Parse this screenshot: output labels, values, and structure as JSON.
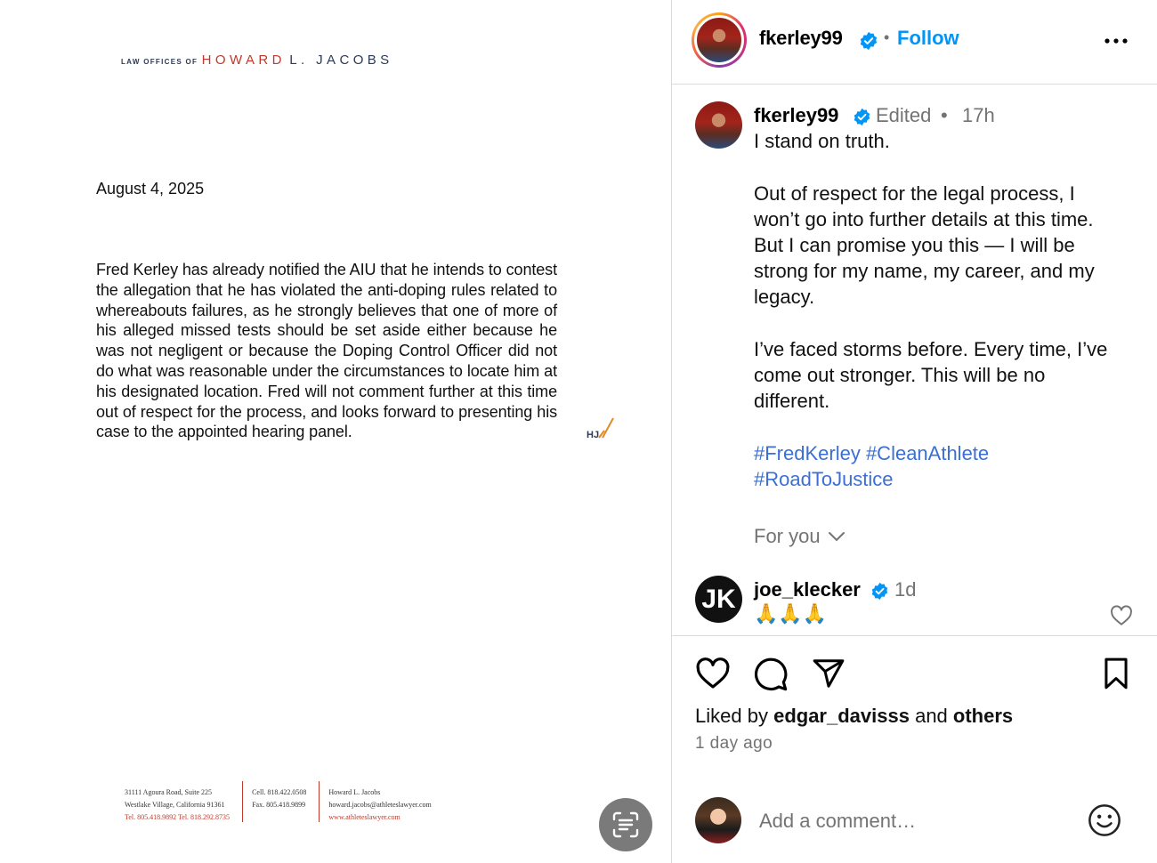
{
  "document": {
    "logo_prefix": "LAW OFFICES OF",
    "logo_firm_first": "HOWARD",
    "logo_firm_rest": "L. JACOBS",
    "date": "August 4, 2025",
    "body": "Fred Kerley has already notified the AIU that he intends to contest the allegation that he has violated the anti-doping rules related to whereabouts failures, as he strongly believes that one of more of his alleged missed tests should be set aside either because he was not negligent or because the Doping Control Officer did not do what was reasonable under the circumstances to locate him at his designated location.  Fred will not comment further at this time out of respect for the process, and looks forward to presenting his case to the appointed hearing panel.",
    "initials": "HJ",
    "footer": {
      "address_line1": "31111 Agoura Road, Suite 225",
      "address_line2": "Westlake Village, California 91361",
      "address_line3": "Tel. 805.418.9892  Tel. 818.292.8735",
      "cell": "Cell. 818.422.0508",
      "fax": "Fax. 805.418.9899",
      "name": "Howard L. Jacobs",
      "email": "howard.jacobs@athleteslawyer.com",
      "website": "www.athleteslawyer.com"
    }
  },
  "post": {
    "header": {
      "username": "fkerley99",
      "dot": "•",
      "follow_label": "Follow"
    },
    "caption": {
      "username": "fkerley99",
      "edited": "Edited",
      "sep": "•",
      "time": "17h",
      "lines": [
        "I stand on truth.",
        "Out of respect for the legal process, I",
        "won’t go into further details at this time.",
        "But I can promise you this — I will be",
        "strong for my name, my career, and my",
        "legacy.",
        "I’ve faced storms before. Every time, I’ve",
        "come out stronger. This will be no",
        "different."
      ],
      "hashtags": [
        "#FredKerley #CleanAthlete",
        "#RoadToJustice"
      ]
    },
    "for_you_label": "For you",
    "comment": {
      "avatar_text": "JK",
      "username": "joe_klecker",
      "time": "1d",
      "text": "🙏🙏🙏"
    },
    "likes": {
      "prefix": "Liked by",
      "user": "edgar_davisss",
      "and": "and",
      "others": "others"
    },
    "posted_ago": "1 day ago",
    "add_comment_placeholder": "Add a comment…"
  },
  "colors": {
    "follow_blue": "#0095f6",
    "hashtag_blue": "#3b6fd6",
    "verified_blue": "#0095f6",
    "logo_red": "#c0392b",
    "logo_navy": "#2b3a55"
  },
  "icons": [
    "visual-search-icon",
    "verified-badge-icon",
    "more-options-icon",
    "chevron-down-icon",
    "heart-icon",
    "comment-icon",
    "share-icon",
    "bookmark-icon",
    "emoji-icon"
  ]
}
